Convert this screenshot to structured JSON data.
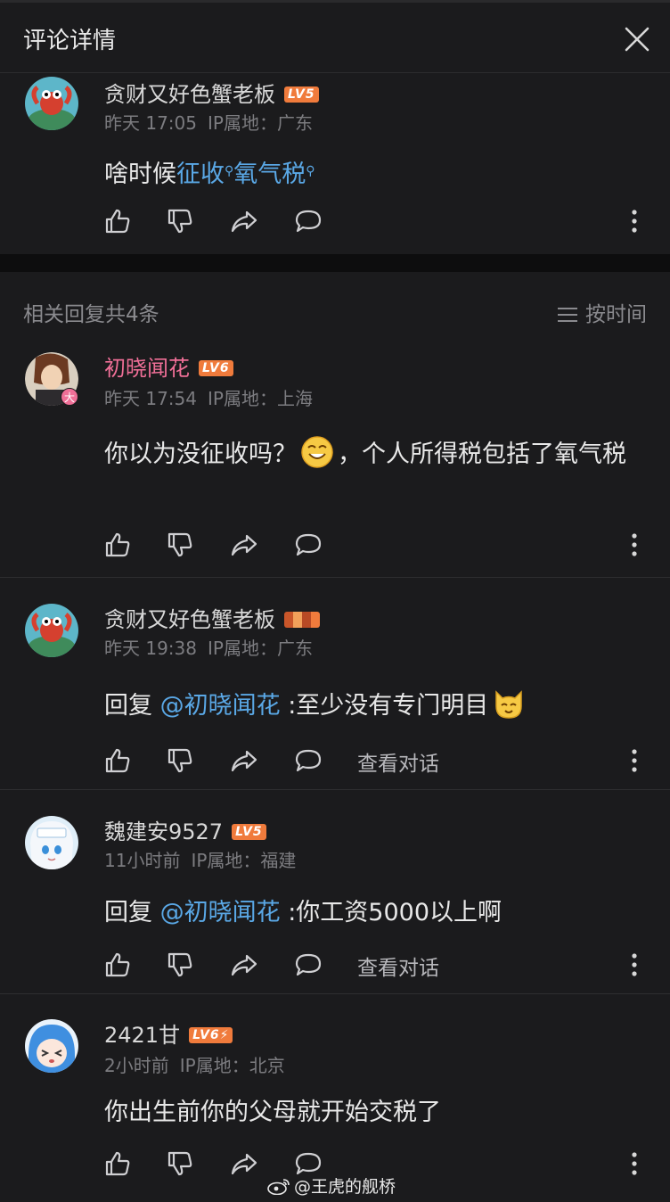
{
  "header": {
    "title": "评论详情"
  },
  "main_comment": {
    "username": "贪财又好色蟹老板",
    "level": "LV5",
    "time": "昨天 17:05",
    "ip": "IP属地：广东",
    "text_parts": [
      "啥时候",
      "征收",
      "氧气税"
    ]
  },
  "replies_header": {
    "count_text": "相关回复共4条",
    "sort_label": "按时间"
  },
  "replies": [
    {
      "username": "初晓闻花",
      "level": "LV6",
      "badge": "大",
      "time": "昨天 17:54",
      "ip": "IP属地：上海",
      "text_a": "你以为没征收吗？",
      "text_b": "，个人所得税包括了氧气税"
    },
    {
      "username": "贪财又好色蟹老板",
      "time": "昨天 19:38",
      "ip": "IP属地：广东",
      "reply_prefix": "回复",
      "mention": "@初晓闻花",
      "text": ":至少没有专门明目",
      "view_conversation": "查看对话"
    },
    {
      "username": "魏建安9527",
      "level": "LV5",
      "time": "11小时前",
      "ip": "IP属地：福建",
      "reply_prefix": "回复",
      "mention": "@初晓闻花",
      "text": ":你工资5000以上啊",
      "view_conversation": "查看对话"
    },
    {
      "username": "2421甘",
      "level": "LV6⚡",
      "time": "2小时前",
      "ip": "IP属地：北京",
      "text": "你出生前你的父母就开始交税了"
    }
  ],
  "watermark": "@王虎的舰桥",
  "colors": {
    "background": "#1b1b1d",
    "link": "#5aa8e6",
    "username_highlight": "#ef6f97",
    "level_badge": "#f07b3c"
  }
}
